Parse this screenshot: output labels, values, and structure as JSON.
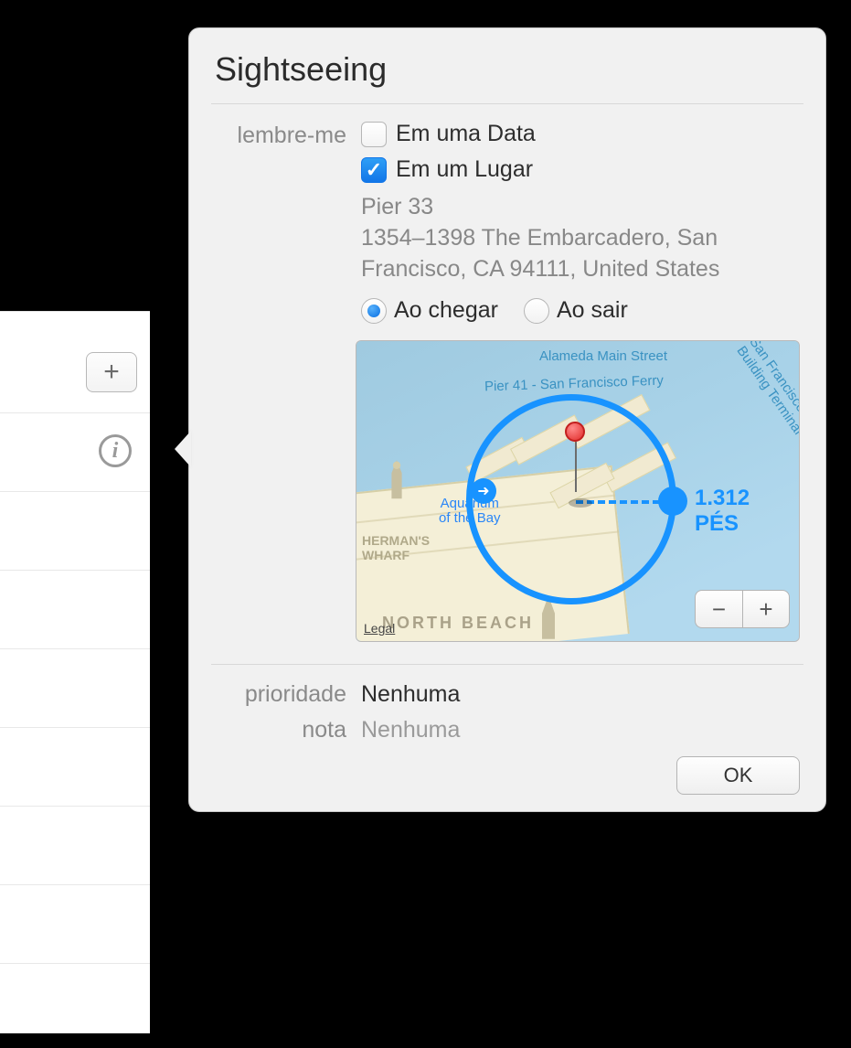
{
  "list_panel": {
    "add_label": "+"
  },
  "popover": {
    "title": "Sightseeing",
    "remind_label": "lembre-me",
    "on_date_label": "Em uma Data",
    "on_date_checked": false,
    "at_location_label": "Em um Lugar",
    "at_location_checked": true,
    "location": {
      "name": "Pier 33",
      "line1": "1354–1398 The Embarcadero, San",
      "line2": "Francisco, CA  94111, United States"
    },
    "radio": {
      "arriving_label": "Ao chegar",
      "leaving_label": "Ao sair",
      "selected": "arriving"
    },
    "map": {
      "distance_label": "1.312 PÉS",
      "legal_label": "Legal",
      "labels": {
        "alameda": "Alameda Main Street",
        "pier41": "Pier 41 - San Francisco Ferry",
        "aquarium": "Aquarium of the Bay",
        "hermans": "HERMAN'S WHARF",
        "northbeach": "NORTH BEACH",
        "ferry": "San Francisco Ferry Building Terminal"
      },
      "zoom_out": "−",
      "zoom_in": "+"
    },
    "priority_label": "prioridade",
    "priority_value": "Nenhuma",
    "note_label": "nota",
    "note_placeholder": "Nenhuma",
    "ok_label": "OK"
  }
}
